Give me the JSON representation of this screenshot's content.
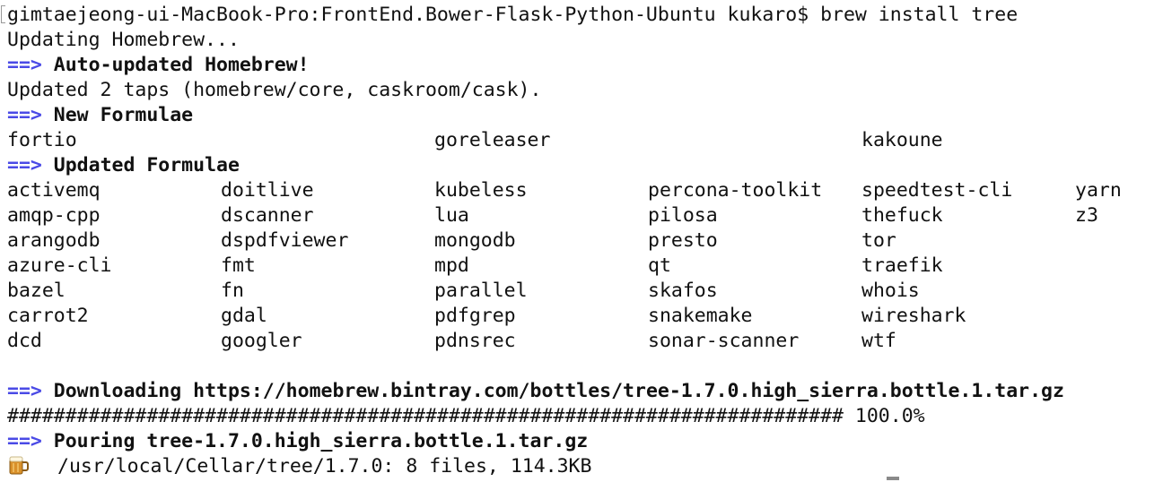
{
  "terminal": {
    "prompt_line": "gimtaejeong-ui-MacBook-Pro:FrontEnd.Bower-Flask-Python-Ubuntu kukaro$ brew install tree",
    "arrow": "==>",
    "updating": "Updating Homebrew...",
    "auto_updated": "Auto-updated Homebrew!",
    "updated_taps": "Updated 2 taps (homebrew/core, caskroom/cask).",
    "new_formulae_header": "New Formulae",
    "new_formulae": [
      "fortio",
      "goreleaser",
      "kakoune"
    ],
    "updated_formulae_header": "Updated Formulae",
    "updated_formulae_rows": [
      [
        "activemq",
        "doitlive",
        "kubeless",
        "percona-toolkit",
        "speedtest-cli",
        "yarn"
      ],
      [
        "amqp-cpp",
        "dscanner",
        "lua",
        "pilosa",
        "thefuck",
        "z3"
      ],
      [
        "arangodb",
        "dspdfviewer",
        "mongodb",
        "presto",
        "tor",
        ""
      ],
      [
        "azure-cli",
        "fmt",
        "mpd",
        "qt",
        "traefik",
        ""
      ],
      [
        "bazel",
        "fn",
        "parallel",
        "skafos",
        "whois",
        ""
      ],
      [
        "carrot2",
        "gdal",
        "pdfgrep",
        "snakemake",
        "wireshark",
        ""
      ],
      [
        "dcd",
        "googler",
        "pdnsrec",
        "sonar-scanner",
        "wtf",
        ""
      ]
    ],
    "downloading": "Downloading https://homebrew.bintray.com/bottles/tree-1.7.0.high_sierra.bottle.1.tar.gz",
    "progress_bar": "######################################################################## 100.0%",
    "pouring": "Pouring tree-1.7.0.high_sierra.bottle.1.tar.gz",
    "summary": "/usr/local/Cellar/tree/1.7.0: 8 files, 114.3KB",
    "summary_icon": "beer-mug-icon",
    "colors": {
      "arrow": "#4a4ae6",
      "text": "#111111",
      "background": "#ffffff"
    }
  }
}
